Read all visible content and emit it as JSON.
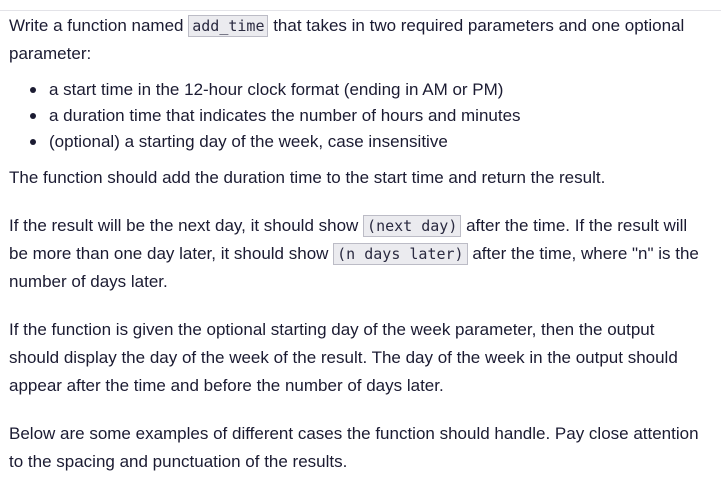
{
  "intro": {
    "before": "Write a function named ",
    "code": "add_time",
    "after": " that takes in two required parameters and one optional parameter:"
  },
  "list": [
    "a start time in the 12-hour clock format (ending in AM or PM)",
    "a duration time that indicates the number of hours and minutes",
    "(optional) a starting day of the week, case insensitive"
  ],
  "para_add": "The function should add the duration time to the start time and return the result.",
  "para_next": {
    "t1": "If the result will be the next day, it should show ",
    "code1": "(next day)",
    "t2": " after the time. If the result will be more than one day later, it should show ",
    "code2": "(n days later)",
    "t3": " after the time, where \"n\" is the number of days later."
  },
  "para_optional": "If the function is given the optional starting day of the week parameter, then the output should display the day of the week of the result. The day of the week in the output should appear after the time and before the number of days later.",
  "para_examples": "Below are some examples of different cases the function should handle. Pay close attention to the spacing and punctuation of the results."
}
